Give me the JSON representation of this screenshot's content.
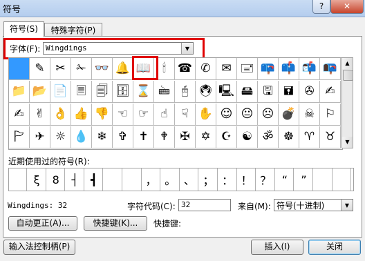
{
  "window": {
    "title": "符号",
    "help_glyph": "?",
    "close_glyph": "✕"
  },
  "tabs": [
    {
      "label": "符号(S)",
      "active": true
    },
    {
      "label": "特殊字符(P)",
      "active": false
    }
  ],
  "font": {
    "label": "字体(F):",
    "value": "Wingdings"
  },
  "symbol_grid": {
    "rows": [
      [
        "",
        "✎",
        "✂",
        "✁",
        "👓",
        "🔔",
        "📖",
        "🕯",
        "☎",
        "✆",
        "✉",
        "🖃",
        "📪",
        "📫",
        "📬",
        "📭"
      ],
      [
        "📁",
        "📂",
        "📄",
        "🗏",
        "🗐",
        "🗄",
        "⌛",
        "🖮",
        "🖰",
        "🖲",
        "🖳",
        "🖴",
        "🖫",
        "🖬",
        "✇",
        "✍"
      ],
      [
        "✍",
        "✌",
        "👌",
        "👍",
        "👎",
        "☜",
        "☞",
        "☝",
        "☟",
        "✋",
        "☺",
        "😐",
        "☹",
        "💣",
        "☠",
        "⚐"
      ],
      [
        "🏱",
        "✈",
        "☼",
        "💧",
        "❄",
        "✞",
        "✝",
        "🕈",
        "✠",
        "✡",
        "☪",
        "☯",
        "ॐ",
        "☸",
        "♈",
        "♉"
      ]
    ],
    "selected_index": 0,
    "highlighted_symbol": "📖"
  },
  "recent": {
    "label": "近期使用过的符号(R):",
    "symbols": [
      "",
      "ξ",
      "8",
      "┤",
      "┫",
      "",
      "",
      "，",
      "。",
      "、",
      "；",
      "：",
      "！",
      "？",
      "“",
      "”",
      "",
      ""
    ]
  },
  "info": {
    "font_code": "Wingdings: 32",
    "char_code_label": "字符代码(C):",
    "char_code_value": "32",
    "from_label": "来自(M):",
    "from_value": "符号(十进制)"
  },
  "buttons": {
    "autocorrect": "自动更正(A)...",
    "shortcut_key": "快捷键(K)...",
    "shortcut_label": "快捷键:",
    "ime": "输入法控制柄(P)",
    "insert": "插入(I)",
    "close": "关闭"
  }
}
